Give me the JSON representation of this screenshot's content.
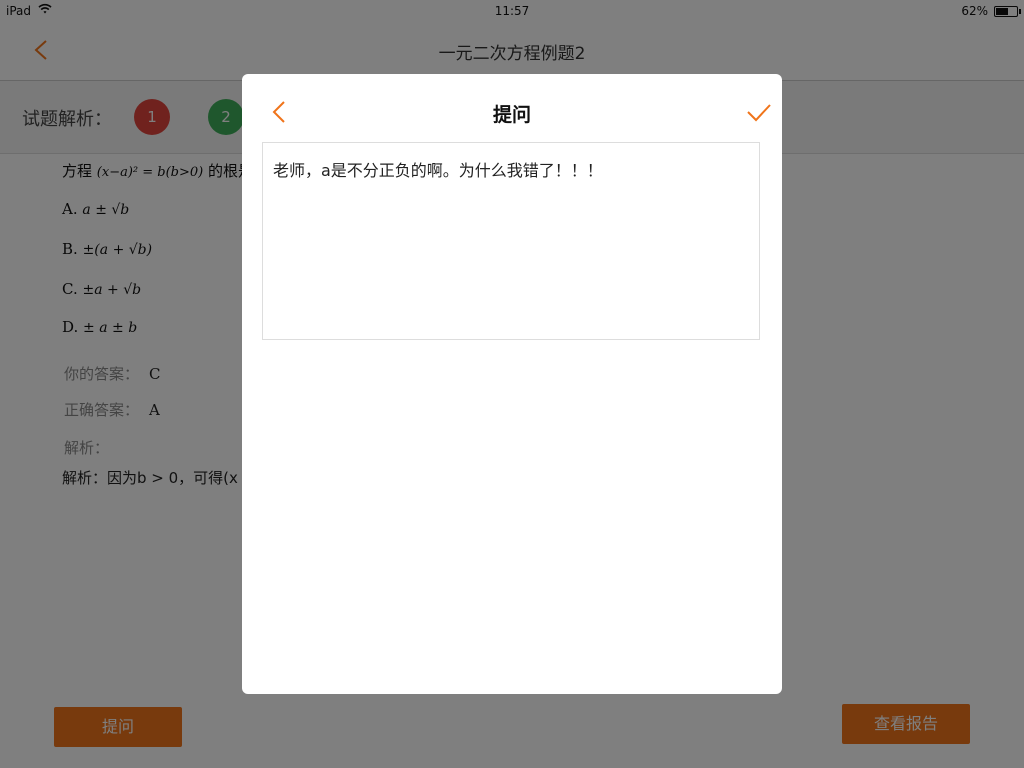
{
  "status_bar": {
    "carrier": "iPad",
    "time": "11:57",
    "battery": "62%"
  },
  "nav": {
    "title": "一元二次方程例题2"
  },
  "analysis": {
    "label": "试题解析：",
    "question_numbers": [
      "1",
      "2"
    ]
  },
  "question": {
    "stem_prefix": "方程",
    "stem_math": "(x−a)² = b(b>0)",
    "stem_suffix": "的根是",
    "options": [
      {
        "label": "A.",
        "math": "a ± √b"
      },
      {
        "label": "B.",
        "math": "±(a + √b)"
      },
      {
        "label": "C.",
        "math": "±a + √b"
      },
      {
        "label": "D.",
        "math": "± a ± b"
      }
    ],
    "your_answer_label": "你的答案：",
    "your_answer": "C",
    "correct_answer_label": "正确答案：",
    "correct_answer": "A",
    "analysis_label": "解析：",
    "analysis_text": "解析：因为b > 0，可得(x"
  },
  "buttons": {
    "ask": "提问",
    "report": "查看报告"
  },
  "modal": {
    "title": "提问",
    "text": "老师，a是不分正负的啊。为什么我错了！！！"
  },
  "colors": {
    "accent": "#f0741a",
    "q1": "#e0453d",
    "q2": "#3fae5a"
  }
}
